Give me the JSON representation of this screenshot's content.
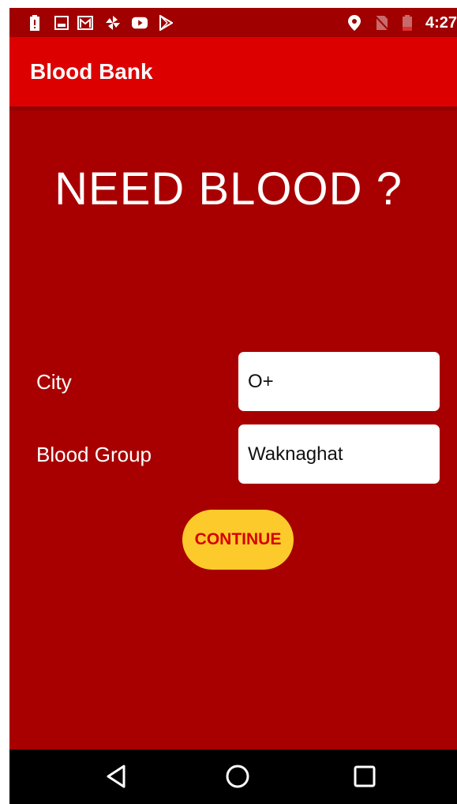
{
  "status_bar": {
    "time": "4:27",
    "icons": [
      "alert-icon",
      "image-icon",
      "gmail-icon",
      "pinwheel-icon",
      "youtube-icon",
      "play-store-icon",
      "location-icon",
      "no-sim-icon",
      "battery-icon"
    ]
  },
  "app_bar": {
    "title": "Blood Bank"
  },
  "main": {
    "headline": "NEED BLOOD ?",
    "city_label": "City",
    "city_value": "O+",
    "blood_group_label": "Blood Group",
    "blood_group_value": "Waknaghat",
    "continue_label": "CONTINUE"
  },
  "nav_bar": {
    "icons": [
      "back-icon",
      "home-icon",
      "recents-icon"
    ]
  },
  "colors": {
    "background": "#a80000",
    "status_bar": "#a00000",
    "app_bar": "#dd0000",
    "button": "#fdca2c",
    "button_text": "#d60000"
  }
}
